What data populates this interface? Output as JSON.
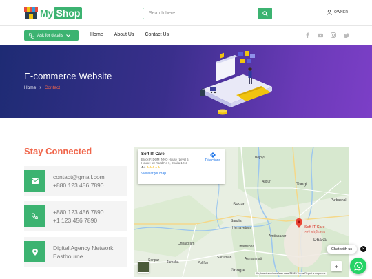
{
  "header": {
    "logo_my": "My",
    "logo_shop": "Shop",
    "search_placeholder": "Search here...",
    "owner_label": "OWNER"
  },
  "nav": {
    "ask_label": "Ask for details",
    "links": [
      "Home",
      "About Us",
      "Contact Us"
    ],
    "social_icons": [
      "facebook-icon",
      "youtube-icon",
      "instagram-icon",
      "twitter-icon"
    ]
  },
  "hero": {
    "title": "E-commerce Website",
    "breadcrumb": {
      "home": "Home",
      "current": "Contact"
    }
  },
  "contact": {
    "title": "Stay Connected",
    "cards": [
      {
        "icon": "mail-icon",
        "lines": [
          "contact@gmail.com",
          "+880 123 456 7890"
        ]
      },
      {
        "icon": "phone-icon",
        "lines": [
          "+880 123 456 7890",
          "+1 123 456 7890"
        ]
      },
      {
        "icon": "location-icon",
        "lines": [
          "Digital Agency Network",
          "Eastbourne"
        ]
      }
    ]
  },
  "map": {
    "place_name": "Soft IT Care",
    "address": "Block-F, DOM INNO House (Level 6, House: 13 Road No 7, Dhaka 1213",
    "rating": "4.4",
    "stars": "★★★★★",
    "view_larger": "View larger map",
    "directions": "Directions",
    "pin_label": "Soft IT Care",
    "pin_sub": "সফট আইটি কেয়ার",
    "places": [
      "Bejoyi",
      "Alipur",
      "Tongi",
      "Purbachal",
      "Savar",
      "Sarulia",
      "Dhaka",
      "Chhalgram",
      "Hemayetpur",
      "Amtiabazar",
      "Dhamsona",
      "Sarukhan",
      "Jamsha",
      "Polifun",
      "Asmanmati",
      "Sonpur"
    ],
    "footer": "Keyboard shortcuts   Map data ©2025   Terms   Report a map error",
    "google": "Google"
  },
  "colors": {
    "brand_green": "#3cb371",
    "accent_orange": "#f0654a",
    "hero_start": "#1e2b74",
    "hero_end": "#7c3fc7"
  },
  "chat": {
    "label": "Chat with us",
    "close": "×"
  }
}
